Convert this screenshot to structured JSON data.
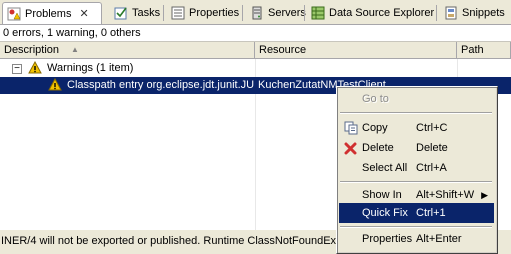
{
  "tabs": [
    {
      "label": "Problems",
      "icon": "problems-icon",
      "active": true
    },
    {
      "label": "Tasks",
      "icon": "tasks-icon"
    },
    {
      "label": "Properties",
      "icon": "properties-icon"
    },
    {
      "label": "Servers",
      "icon": "servers-icon"
    },
    {
      "label": "Data Source Explorer",
      "icon": "data-source-icon"
    },
    {
      "label": "Snippets",
      "icon": "snippets-icon"
    }
  ],
  "close_glyph": "✕",
  "summary": "0 errors, 1 warning, 0 others",
  "columns": {
    "description": "Description",
    "resource": "Resource",
    "path": "Path"
  },
  "group": {
    "expander": "−",
    "label": "Warnings (1 item)"
  },
  "warning_row": {
    "description": "Classpath entry org.eclipse.jdt.junit.JU",
    "resource": "KuchenZutatNMTestClient"
  },
  "status_message": "INER/4 will not be exported or published. Runtime ClassNotFoundExce",
  "context_menu": {
    "goto": "Go to",
    "copy": {
      "label": "Copy",
      "accel": "Ctrl+C"
    },
    "delete": {
      "label": "Delete",
      "accel": "Delete"
    },
    "select_all": {
      "label": "Select All",
      "accel": "Ctrl+A"
    },
    "show_in": {
      "label": "Show In",
      "accel": "Alt+Shift+W"
    },
    "quick_fix": {
      "label": "Quick Fix",
      "accel": "Ctrl+1"
    },
    "properties": {
      "label": "Properties",
      "accel": "Alt+Enter"
    }
  },
  "colors": {
    "selection": "#0a246a",
    "warning": "#f2c200",
    "error": "#d03030"
  }
}
